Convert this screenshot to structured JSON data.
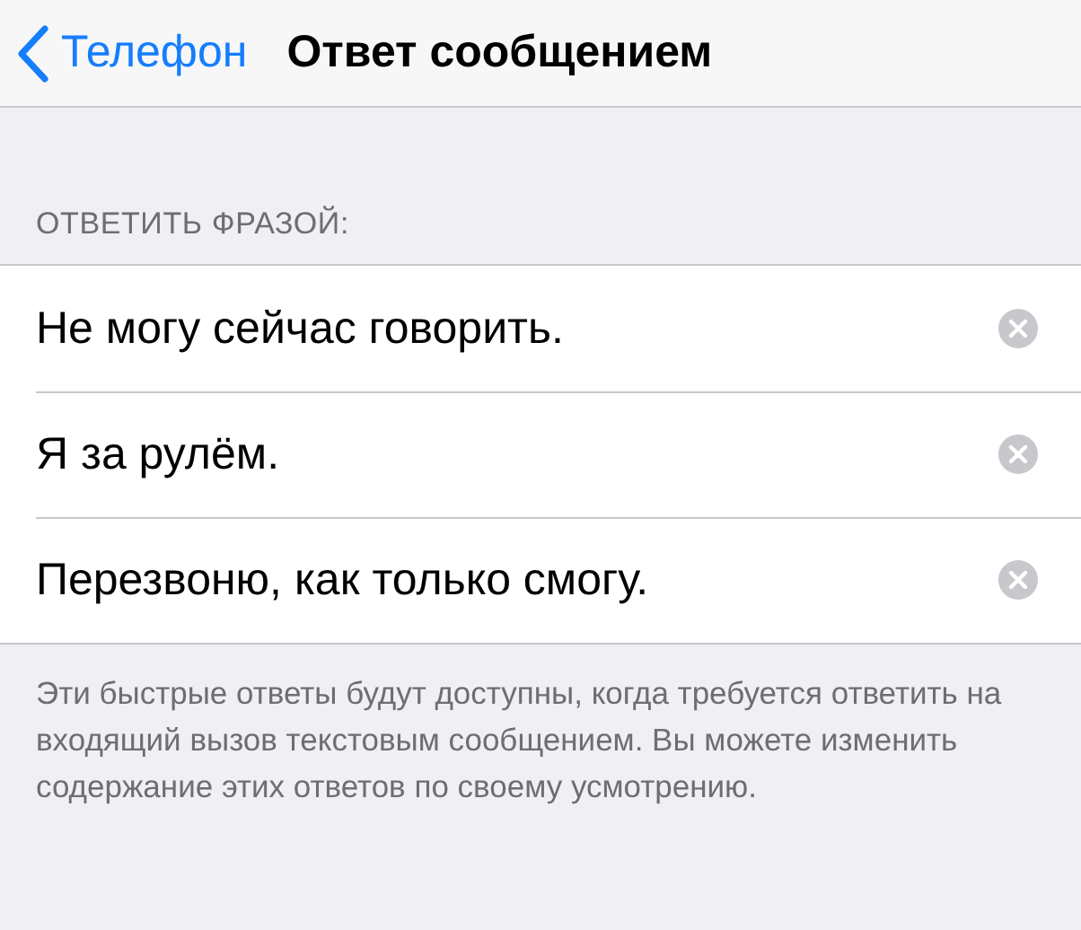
{
  "nav": {
    "back": "Телефон",
    "title": "Ответ сообщением"
  },
  "section": {
    "header": "ОТВЕТИТЬ ФРАЗОЙ:",
    "rows": [
      {
        "text": "Не могу сейчас говорить."
      },
      {
        "text": "Я за рулём."
      },
      {
        "text": "Перезвоню, как только смогу."
      }
    ],
    "footer": "Эти быстрые ответы будут доступны, когда требуется ответить на входящий вызов текстовым сообщением. Вы можете изменить содержание этих ответов по своему усмотрению."
  }
}
